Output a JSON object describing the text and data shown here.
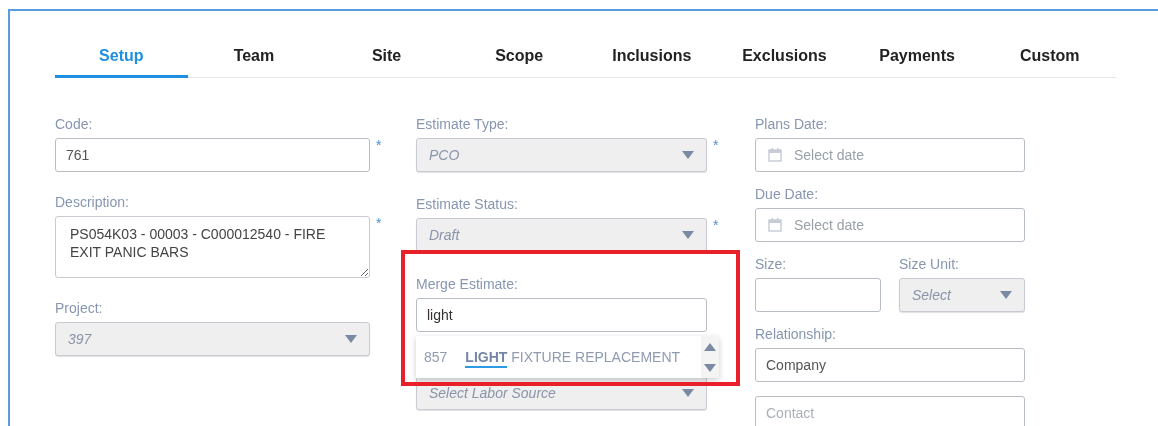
{
  "tabs": [
    {
      "label": "Setup",
      "selected": true
    },
    {
      "label": "Team",
      "selected": false
    },
    {
      "label": "Site",
      "selected": false
    },
    {
      "label": "Scope",
      "selected": false
    },
    {
      "label": "Inclusions",
      "selected": false
    },
    {
      "label": "Exclusions",
      "selected": false
    },
    {
      "label": "Payments",
      "selected": false
    },
    {
      "label": "Custom",
      "selected": false
    }
  ],
  "columns": [
    [
      {
        "kind": "text",
        "label": "Code:",
        "value": "761",
        "marker": "*"
      },
      {
        "kind": "textarea",
        "label": "Description:",
        "value": "PS054K03 - 00003 - C000012540 - FIRE EXIT PANIC BARS",
        "marker": "*"
      },
      {
        "kind": "select",
        "label": "Project:",
        "value": "397",
        "disabled": true
      }
    ],
    [
      {
        "kind": "select",
        "label": "Estimate Type:",
        "value": "PCO",
        "disabled": true,
        "marker": "*"
      },
      {
        "kind": "select",
        "label": "Estimate Status:",
        "value": "Draft",
        "disabled": true,
        "marker": "*"
      },
      {
        "kind": "autocomplete",
        "label": "Merge Estimate:",
        "value": "light",
        "highlighted": true,
        "suggestions": [
          {
            "code": "857",
            "match": "LIGHT",
            "rest": "FIXTURE REPLACEMENT"
          }
        ]
      },
      {
        "kind": "select",
        "placeholder": "Select Labor Source",
        "disabled": true
      }
    ],
    [
      {
        "kind": "date",
        "label": "Plans Date:",
        "placeholder": "Select date"
      },
      {
        "kind": "date",
        "label": "Due Date:",
        "placeholder": "Select date"
      },
      {
        "kind": "pair",
        "items": [
          {
            "kind": "text",
            "label": "Size:"
          },
          {
            "kind": "select",
            "label": "Size Unit:",
            "placeholder": "Select",
            "disabled": true
          }
        ]
      },
      {
        "kind": "text",
        "label": "Relationship:",
        "value": "Company"
      },
      {
        "kind": "text",
        "placeholder": "Contact"
      }
    ]
  ]
}
